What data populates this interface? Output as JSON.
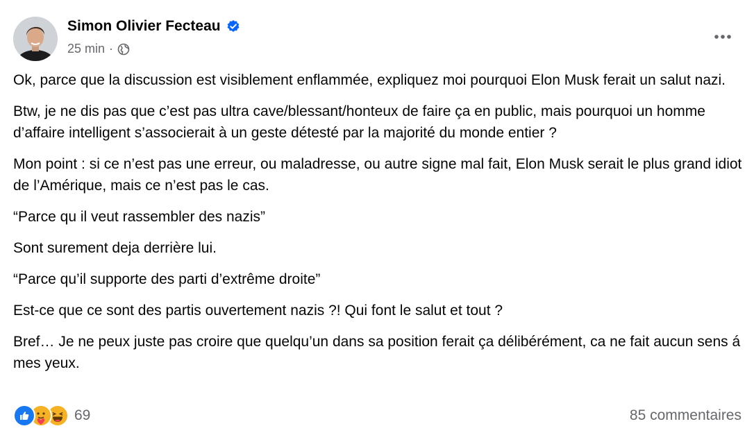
{
  "post": {
    "author": "Simon Olivier Fecteau",
    "time": "25 min",
    "separator": "·",
    "paragraphs": [
      "Ok, parce que la discussion est visiblement enflammée, expliquez moi pourquoi Elon Musk ferait un salut nazi.",
      "Btw, je ne dis pas que c’est pas ultra cave/blessant/honteux de faire ça en public, mais pourquoi un homme d’affaire intelligent s’associerait à un geste détesté par la majorité du monde entier ?",
      "Mon point : si ce n’est pas une erreur, ou maladresse, ou autre signe mal fait, Elon Musk serait le plus grand idiot de l’Amérique, mais ce n’est pas le cas.",
      "“Parce qu il veut rassembler des nazis”",
      "Sont surement deja derrière lui.",
      "“Parce qu’il supporte des parti d’extrême droite”",
      "Est-ce que ce sont des partis ouvertement nazis ?! Qui font le salut et tout ?",
      "Bref… Je ne peux juste pas croire que quelqu’un dans sa position ferait ça délibérément, ca ne fait aucun sens á mes yeux."
    ],
    "reaction_count": "69",
    "comments": "85 commentaires"
  },
  "icons": {
    "verified": "verified-badge-icon",
    "globe": "globe-icon",
    "more": "more-options-icon",
    "reactions": [
      "like-icon",
      "care-icon",
      "haha-icon"
    ]
  },
  "colors": {
    "like_blue": "#1877f2",
    "verified_blue": "#0866ff",
    "secondary_text": "#65676b",
    "reaction_yellow": "#f7b125"
  }
}
